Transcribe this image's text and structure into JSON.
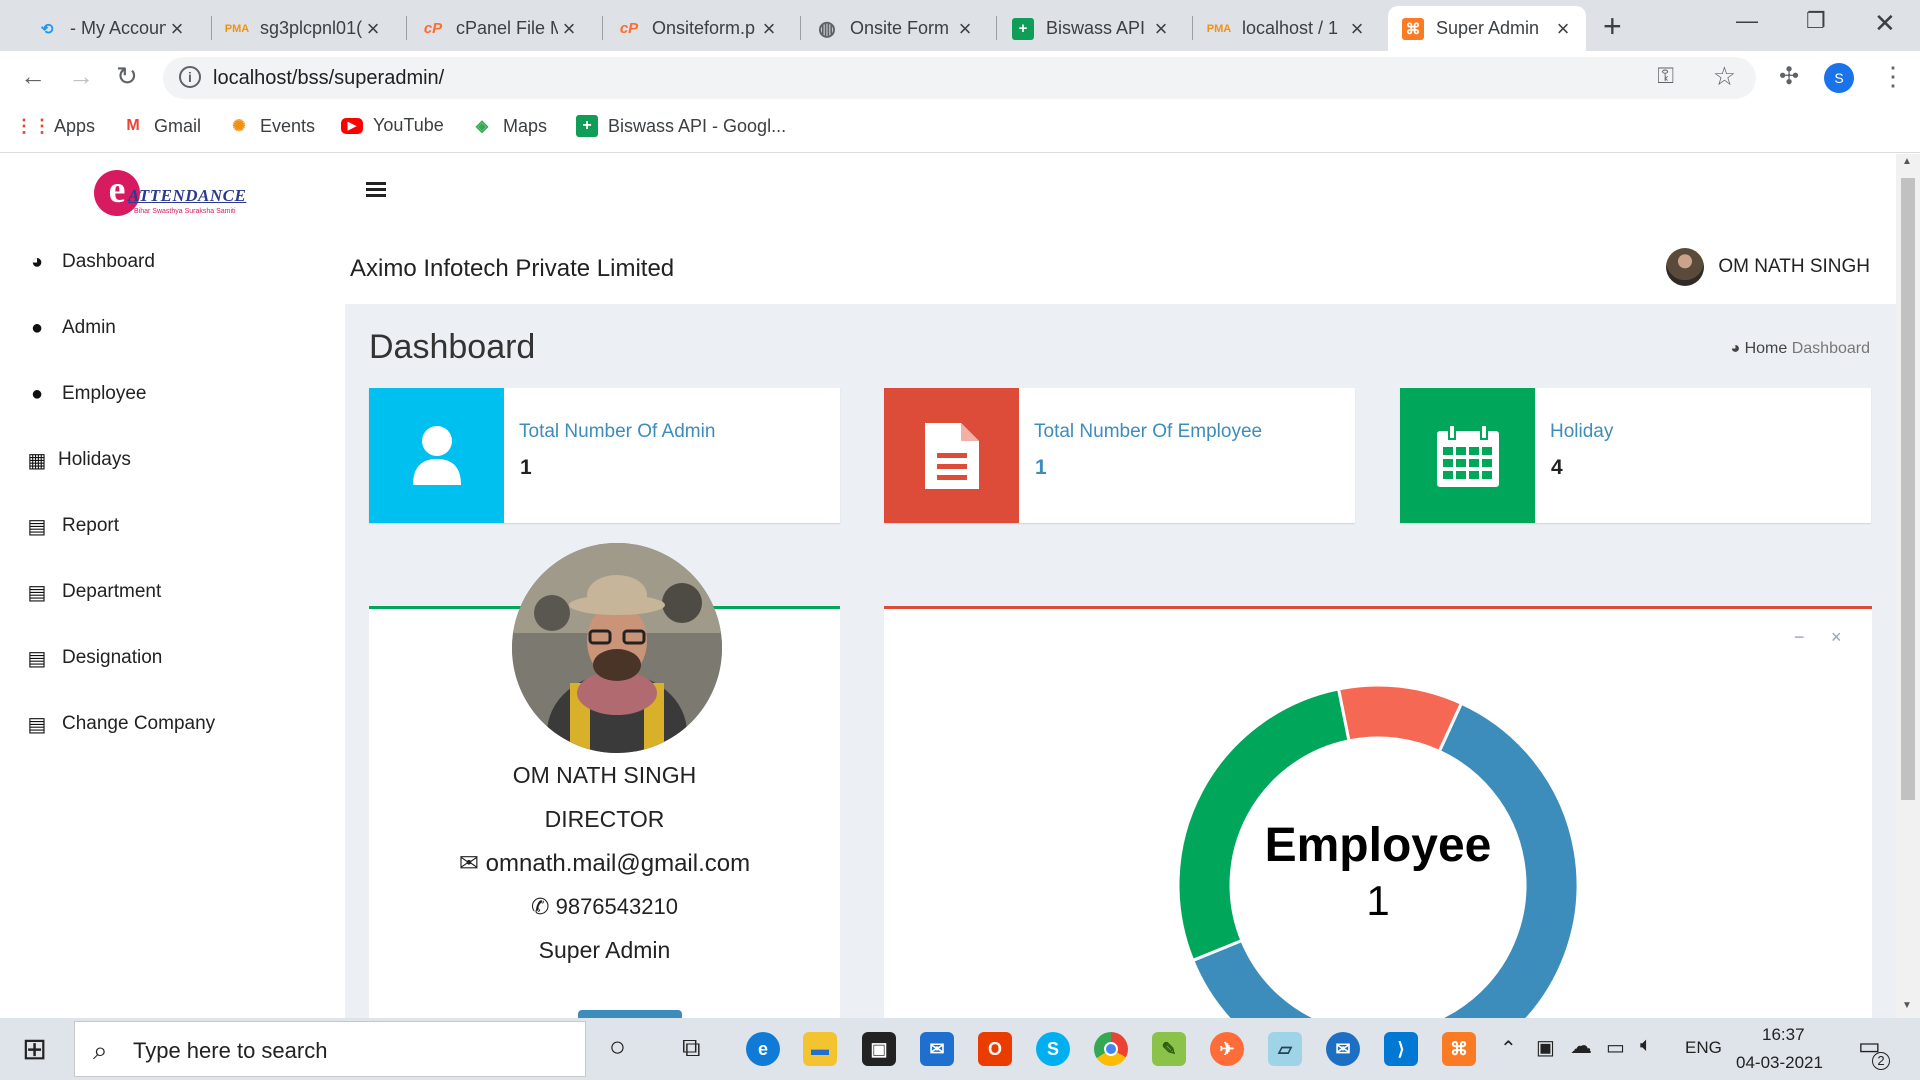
{
  "browser": {
    "tabs": [
      {
        "title": "- My Accoun",
        "favicon": "swirl-icon",
        "color": "#2196f3"
      },
      {
        "title": "sg3plcpnl01(",
        "favicon": "phpmyadmin-icon",
        "color": "#f29111"
      },
      {
        "title": "cPanel File M",
        "favicon": "cpanel-icon",
        "color": "#ff6c2c"
      },
      {
        "title": "Onsiteform.p",
        "favicon": "cpanel-icon",
        "color": "#ff6c2c"
      },
      {
        "title": "Onsite Form",
        "favicon": "globe-icon",
        "color": "#5f6368"
      },
      {
        "title": "Biswass API",
        "favicon": "sheets-icon",
        "color": "#0f9d58"
      },
      {
        "title": "localhost / 1",
        "favicon": "phpmyadmin-icon",
        "color": "#f29111"
      },
      {
        "title": "Super Admin",
        "favicon": "xampp-icon",
        "color": "#fb7a24"
      }
    ],
    "url": "localhost/bss/superadmin/",
    "profile_initial": "S",
    "bookmarks": [
      {
        "label": "Apps",
        "icon": "apps-grid-icon"
      },
      {
        "label": "Gmail",
        "icon": "gmail-icon"
      },
      {
        "label": "Events",
        "icon": "events-icon"
      },
      {
        "label": "YouTube",
        "icon": "youtube-icon"
      },
      {
        "label": "Maps",
        "icon": "maps-icon"
      },
      {
        "label": "Biswass API - Googl...",
        "icon": "sheets-icon"
      }
    ]
  },
  "app": {
    "logo_letter": "e",
    "logo_text": "ATTENDANCE",
    "logo_tagline": "Bihar Swasthya Suraksha Samiti",
    "company": "Aximo Infotech Private Limited",
    "user_name": "OM NATH SINGH",
    "page_title": "Dashboard",
    "breadcrumb": {
      "home": "Home",
      "current": "Dashboard"
    },
    "sidebar": [
      {
        "label": "Dashboard",
        "icon": "dashboard-icon"
      },
      {
        "label": "Admin",
        "icon": "user-icon"
      },
      {
        "label": "Employee",
        "icon": "user-icon"
      },
      {
        "label": "Holidays",
        "icon": "calendar-icon"
      },
      {
        "label": "Report",
        "icon": "file-icon"
      },
      {
        "label": "Department",
        "icon": "file-icon"
      },
      {
        "label": "Designation",
        "icon": "file-icon"
      },
      {
        "label": "Change Company",
        "icon": "file-icon"
      }
    ],
    "info_boxes": [
      {
        "label": "Total Number Of Admin",
        "value": "1",
        "color": "#00c0ef",
        "icon": "user-icon"
      },
      {
        "label": "Total Number Of Employee",
        "value": "1",
        "color": "#dd4b39",
        "icon": "document-icon"
      },
      {
        "label": "Holiday",
        "value": "4",
        "color": "#00a65a",
        "icon": "calendar-icon"
      }
    ],
    "profile": {
      "name": "OM NATH SINGH",
      "role": "DIRECTOR",
      "email": "omnath.mail@gmail.com",
      "phone": "9876543210",
      "type": "Super Admin"
    },
    "chart_box": {
      "minimize": "−",
      "close": "×"
    }
  },
  "chart_data": {
    "type": "pie",
    "center_label": "Employee",
    "center_value": "1",
    "slices": [
      {
        "value": 62,
        "color": "#3c8dbc"
      },
      {
        "value": 28,
        "color": "#00a65a"
      },
      {
        "value": 10,
        "color": "#f56954"
      }
    ]
  },
  "taskbar": {
    "search_placeholder": "Type here to search",
    "language": "ENG",
    "time": "16:37",
    "date": "04-03-2021",
    "notification_count": "2"
  }
}
